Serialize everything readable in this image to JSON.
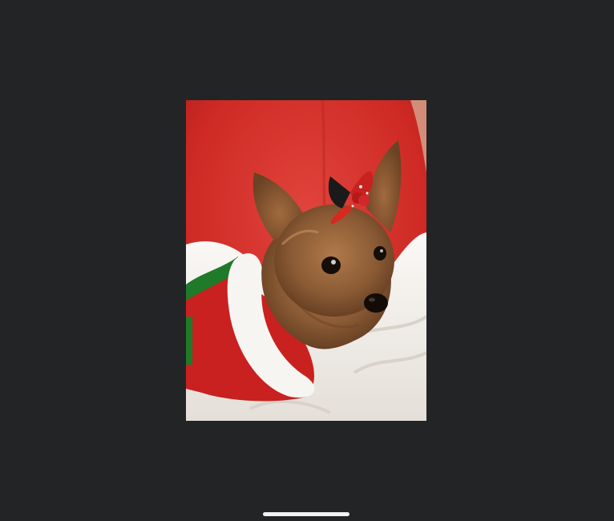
{
  "viewer": {
    "background_color": "#232426",
    "photo": {
      "alt": "",
      "subject_icon": "dog-photo",
      "palette": {
        "backdrop_red": "#cf2a25",
        "fur_brown": "#8a5a34",
        "blanket_white": "#f1eeea",
        "costume_red": "#c8211f",
        "bow_green": "#1f7a2a"
      }
    },
    "home_indicator": {
      "color": "#f2f2f2"
    }
  }
}
